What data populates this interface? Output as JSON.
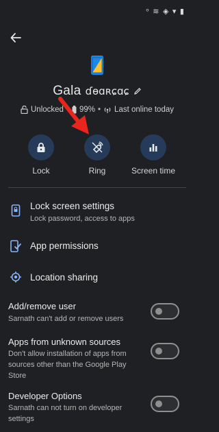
{
  "status_bar": {
    "icons_text": "ᵒ ≋ ◈ ▾ ▮"
  },
  "header": {
    "back_icon": "arrow-left-icon"
  },
  "device": {
    "name": "Gala",
    "lock_status": "Unlocked",
    "battery": "99%",
    "last_online": "Last online today"
  },
  "quick_actions": [
    {
      "label": "Lock",
      "icon": "lock-icon"
    },
    {
      "label": "Ring",
      "icon": "ring-icon"
    },
    {
      "label": "Screen time",
      "icon": "bar-chart-icon"
    }
  ],
  "settings": [
    {
      "title": "Lock screen settings",
      "subtitle": "Lock password, access to apps",
      "icon": "phone-lock-icon"
    },
    {
      "title": "App permissions",
      "icon": "app-permissions-icon"
    },
    {
      "title": "Location sharing",
      "icon": "location-icon"
    }
  ],
  "toggles": [
    {
      "title": "Add/remove user",
      "subtitle": "Sarnath can't add or remove users",
      "on": false
    },
    {
      "title": "Apps from unknown sources",
      "subtitle": "Don't allow installation of apps from sources other than the Google Play Store",
      "on": false
    },
    {
      "title": "Developer Options",
      "subtitle": "Sarnath can not turn on developer settings",
      "on": false
    }
  ],
  "colors": {
    "background": "#1f2023",
    "accent_circle": "#263b5a",
    "arrow": "#e8261d"
  }
}
